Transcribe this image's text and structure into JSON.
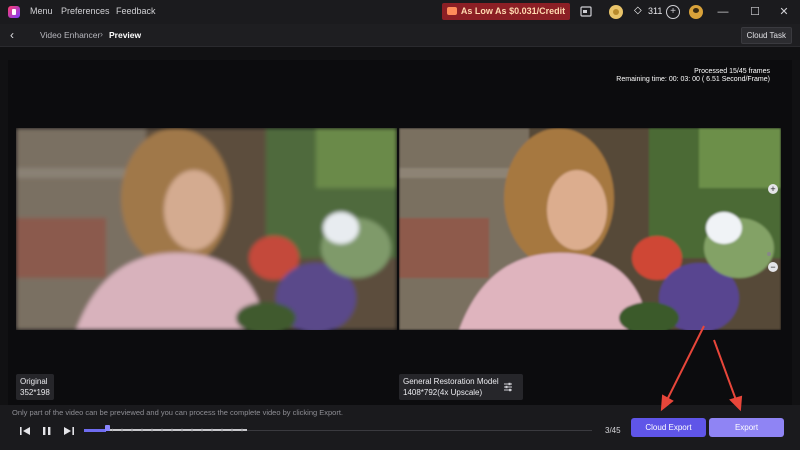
{
  "titlebar": {
    "menu": [
      "Menu",
      "Preferences",
      "Feedback"
    ],
    "promo": "As Low As $0.031/Credit",
    "credits": "311",
    "window_controls": [
      "minimize-icon",
      "maximize-icon",
      "close-icon"
    ]
  },
  "navbar": {
    "breadcrumb": [
      "Video Enhancer",
      "Preview"
    ],
    "cloud_task": "Cloud Task"
  },
  "preview": {
    "progress": {
      "processed": "Processed 15/45 frames",
      "remaining": "Remaining time: 00: 03: 00 ( 6.51 Second/Frame)"
    },
    "original": {
      "title": "Original",
      "resolution": "352*198"
    },
    "enhanced": {
      "title": "General Restoration Model",
      "resolution": "1408*792(4x Upscale)"
    }
  },
  "player": {
    "hint": "Only part of the video can be previewed and you can process the complete video by clicking Export.",
    "frame_counter": "3/45",
    "playhead_fraction": 0.05
  },
  "actions": {
    "cloud_export": "Cloud Export",
    "export": "Export"
  },
  "colors": {
    "accent": "#5f55e8",
    "accent_light": "#8f84f4",
    "promo_bg": "#8c1f25",
    "annotation_arrow": "#e8463a"
  }
}
